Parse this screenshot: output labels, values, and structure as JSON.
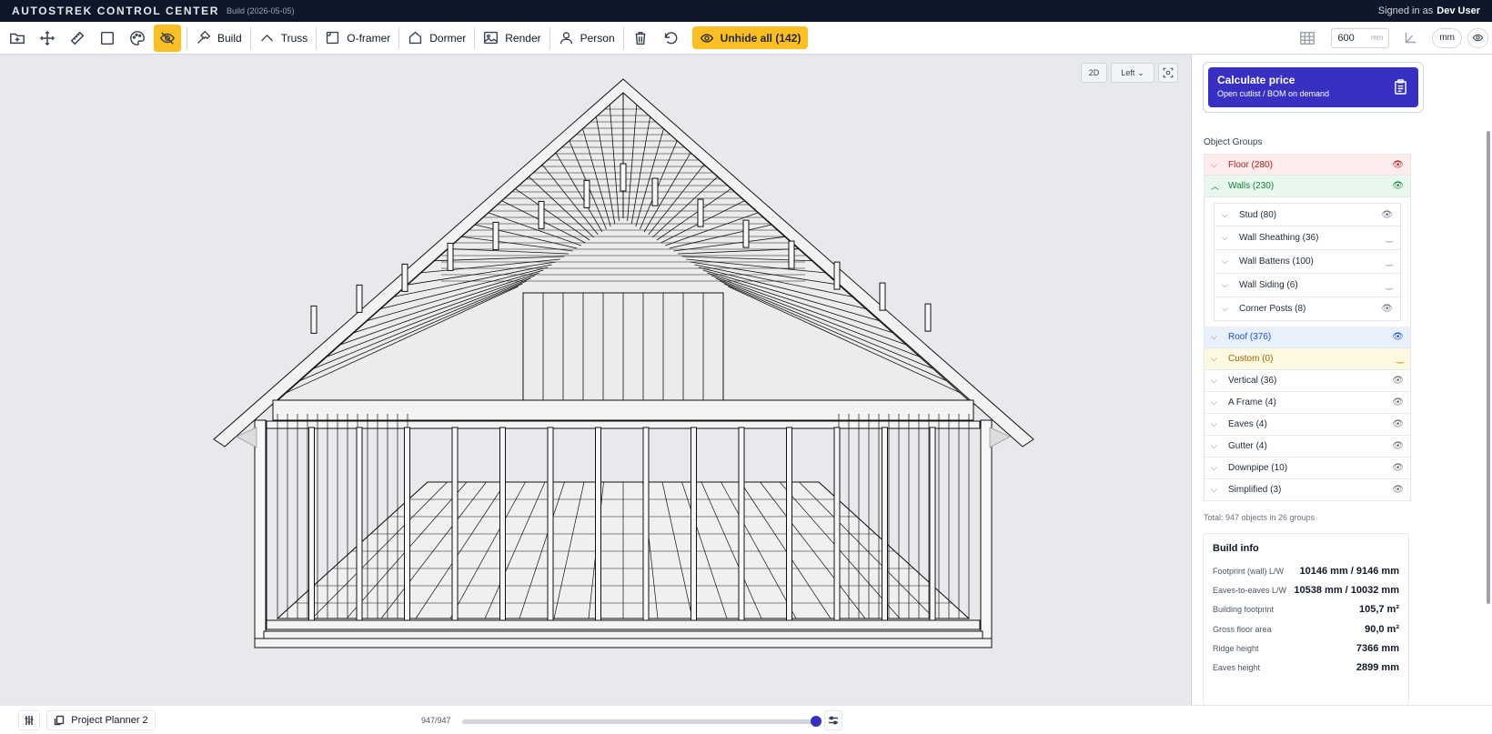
{
  "app": {
    "title": "AUTOSTREK CONTROL CENTER",
    "build": "Build (2026-05-05)",
    "signed_in_label": "Signed in as",
    "user": "Dev User"
  },
  "toolbar": {
    "icon_buttons": [
      {
        "name": "new-folder-icon"
      },
      {
        "name": "move-icon"
      },
      {
        "name": "ruler-icon"
      },
      {
        "name": "select-box-icon"
      },
      {
        "name": "palette-icon"
      },
      {
        "name": "hide-eye-icon",
        "active": true
      }
    ],
    "labeled": [
      {
        "name": "build",
        "label": "Build",
        "icon": "hammer-icon"
      },
      {
        "name": "truss",
        "label": "Truss",
        "icon": "truss-icon"
      },
      {
        "name": "o-framer",
        "label": "O-framer",
        "icon": "frame-icon"
      },
      {
        "name": "dormer",
        "label": "Dormer",
        "icon": "house-icon"
      },
      {
        "name": "render",
        "label": "Render",
        "icon": "image-icon"
      },
      {
        "name": "person",
        "label": "Person",
        "icon": "person-icon"
      }
    ],
    "unhide_label": "Unhide all (142)",
    "grid_value": "600",
    "grid_unit": "mm",
    "unit_label": "mm"
  },
  "viewport": {
    "mode_label": "2D",
    "view_label": "Left"
  },
  "sidebar": {
    "calc_title": "Calculate price",
    "calc_subtitle": "Open cutlist / BOM on demand",
    "section_label": "Object Groups",
    "groups": [
      {
        "label": "Floor (280)",
        "style": "floor",
        "expanded": false
      },
      {
        "label": "Walls (230)",
        "style": "walls",
        "expanded": true
      },
      {
        "label": "Roof (376)",
        "style": "roof",
        "expanded": false
      },
      {
        "label": "Custom (0)",
        "style": "custom",
        "expanded": false
      },
      {
        "label": "Vertical (36)",
        "style": "",
        "expanded": false
      },
      {
        "label": "A Frame (4)",
        "style": "",
        "expanded": false
      },
      {
        "label": "Eaves (4)",
        "style": "",
        "expanded": false
      },
      {
        "label": "Gutter (4)",
        "style": "",
        "expanded": false
      },
      {
        "label": "Downpipe (10)",
        "style": "",
        "expanded": false
      },
      {
        "label": "Simplified (3)",
        "style": "",
        "expanded": false
      }
    ],
    "wall_subgroups": [
      {
        "label": "Stud (80)",
        "visible": true
      },
      {
        "label": "Wall Sheathing (36)",
        "visible": false
      },
      {
        "label": "Wall Battens (100)",
        "visible": false
      },
      {
        "label": "Wall Siding (6)",
        "visible": false
      },
      {
        "label": "Corner Posts (8)",
        "visible": true
      }
    ],
    "total": "Total: 947 objects in 26 groups",
    "build_info": {
      "title": "Build info",
      "rows": [
        {
          "label": "Footprint (wall) L/W",
          "value": "10146 mm / 9146 mm"
        },
        {
          "label": "Eaves-to-eaves L/W",
          "value": "10538 mm / 10032 mm"
        },
        {
          "label": "Building footprint",
          "value": "105,7 m²"
        },
        {
          "label": "Gross floor area",
          "value": "90,0 m²"
        },
        {
          "label": "Ridge height",
          "value": "7366 mm"
        },
        {
          "label": "Eaves height",
          "value": "2899 mm"
        }
      ]
    }
  },
  "bottombar": {
    "project_label": "Project Planner 2",
    "counter": "947/947",
    "visible_count": 947,
    "total_count": 947
  },
  "colors": {
    "accent": "#3730c3",
    "highlight": "#fbbf24",
    "topbar": "#0f172a",
    "floor": "#b91c1c",
    "walls": "#15803d",
    "roof": "#1d4ed8",
    "custom": "#a16207"
  }
}
